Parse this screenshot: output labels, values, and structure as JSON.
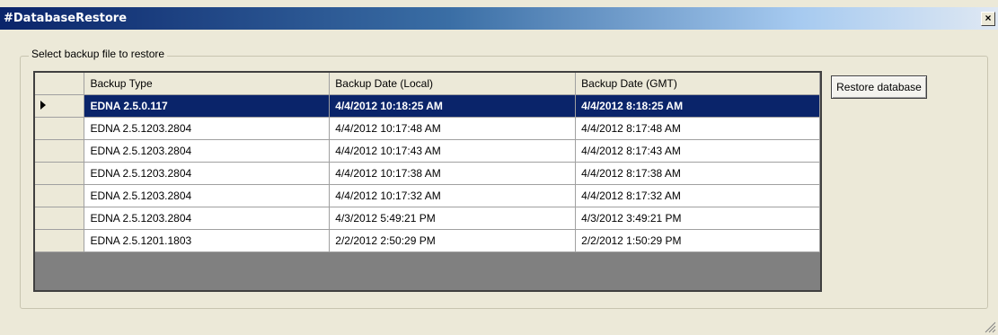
{
  "window": {
    "title": "#DatabaseRestore",
    "close_label": "×"
  },
  "groupbox": {
    "label": "Select backup file to restore"
  },
  "grid": {
    "columns": [
      "Backup Type",
      "Backup Date (Local)",
      "Backup Date (GMT)"
    ],
    "selected_row": 0,
    "rows": [
      {
        "type": "EDNA 2.5.0.117",
        "local": "4/4/2012 10:18:25 AM",
        "gmt": "4/4/2012 8:18:25 AM"
      },
      {
        "type": "EDNA 2.5.1203.2804",
        "local": "4/4/2012 10:17:48 AM",
        "gmt": "4/4/2012 8:17:48 AM"
      },
      {
        "type": "EDNA 2.5.1203.2804",
        "local": "4/4/2012 10:17:43 AM",
        "gmt": "4/4/2012 8:17:43 AM"
      },
      {
        "type": "EDNA 2.5.1203.2804",
        "local": "4/4/2012 10:17:38 AM",
        "gmt": "4/4/2012 8:17:38 AM"
      },
      {
        "type": "EDNA 2.5.1203.2804",
        "local": "4/4/2012 10:17:32 AM",
        "gmt": "4/4/2012 8:17:32 AM"
      },
      {
        "type": "EDNA 2.5.1203.2804",
        "local": "4/3/2012 5:49:21 PM",
        "gmt": "4/3/2012 3:49:21 PM"
      },
      {
        "type": "EDNA 2.5.1201.1803",
        "local": "2/2/2012 2:50:29 PM",
        "gmt": "2/2/2012 1:50:29 PM"
      }
    ]
  },
  "actions": {
    "restore_label": "Restore database"
  },
  "icons": {
    "close": "close-icon",
    "row_indicator": "row-arrow-icon",
    "resize": "resize-grip-icon"
  },
  "colors": {
    "selection": "#0a246a",
    "title_start": "#0a246a",
    "title_end": "#dfe8f3"
  }
}
